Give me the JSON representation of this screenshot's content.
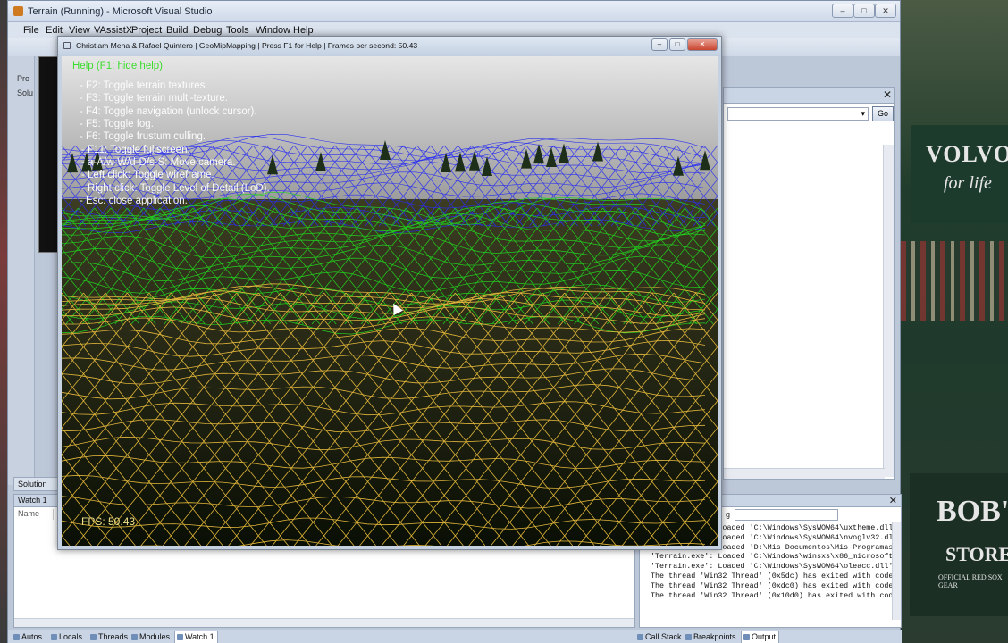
{
  "vs": {
    "title": "Terrain (Running) - Microsoft Visual Studio",
    "menu": [
      "File",
      "Edit",
      "View",
      "VAssistX",
      "Project",
      "Build",
      "Debug",
      "Tools",
      "Window",
      "Help"
    ],
    "caption_buttons": [
      "–",
      "□",
      "✕"
    ],
    "left_strip_labels": [
      "Pro",
      "Solu"
    ],
    "go_label": "Go",
    "solution_tab": "Solution",
    "watch_title": "Watch 1",
    "watch_col_name": "Name",
    "output_show_label": "g",
    "output_lines": [
      "'Terrain.exe': Loaded 'C:\\Windows\\SysWOW64\\uxtheme.dll'",
      "'Terrain.exe': Loaded 'C:\\Windows\\SysWOW64\\nvoglv32.dl",
      "'Terrain.exe': Loaded 'D:\\Mis Documentos\\Mis Programas",
      "'Terrain.exe': Loaded 'C:\\Windows\\winsxs\\x86_microsoft",
      "'Terrain.exe': Loaded 'C:\\Windows\\SysWOW64\\oleacc.dll'",
      "The thread 'Win32 Thread' (0x5dc) has exited with code",
      "The thread 'Win32 Thread' (0xdc0) has exited with code",
      "The thread 'Win32 Thread' (0x10d0) has exited with cod"
    ],
    "bottom_tabs": [
      {
        "label": "Autos"
      },
      {
        "label": "Locals"
      },
      {
        "label": "Threads"
      },
      {
        "label": "Modules"
      },
      {
        "label": "Watch 1"
      },
      {
        "label": "Call Stack"
      },
      {
        "label": "Breakpoints"
      },
      {
        "label": "Output"
      }
    ]
  },
  "terrain": {
    "title": "Christiam Mena & Rafael Quintero | GeoMipMapping | Press F1 for Help | Frames per second: 50.43",
    "help_header": "Help (F1: hide help)",
    "help_lines": [
      "-   F2: Toggle terrain textures.",
      "-   F3: Toggle terrain multi-texture.",
      "-   F4: Toggle navigation (unlock cursor).",
      "-   F5: Toggle fog.",
      "-   F6: Toggle frustum culling.",
      "-  F11: Toggle fullscreen.",
      "-  a-A/w-W/d-D/s-S: Move camera.",
      "-  Left click: Toggle wireframe.",
      "-  Right click: Toggle Level of Detail (LoD).",
      "-  Esc: close application."
    ],
    "fps_label": "FPS: 50.43",
    "wire_colors": {
      "far": "#2a2ff0",
      "mid": "#22d11e",
      "near": "#e0b53a"
    }
  },
  "wallpaper": {
    "sign1_line1": "VOLVO",
    "sign1_line2": "for life",
    "sign2_line1": "BOB'S",
    "sign2_line2": "STORES",
    "sign2_line3": "OFFICIAL RED SOX GEAR"
  }
}
